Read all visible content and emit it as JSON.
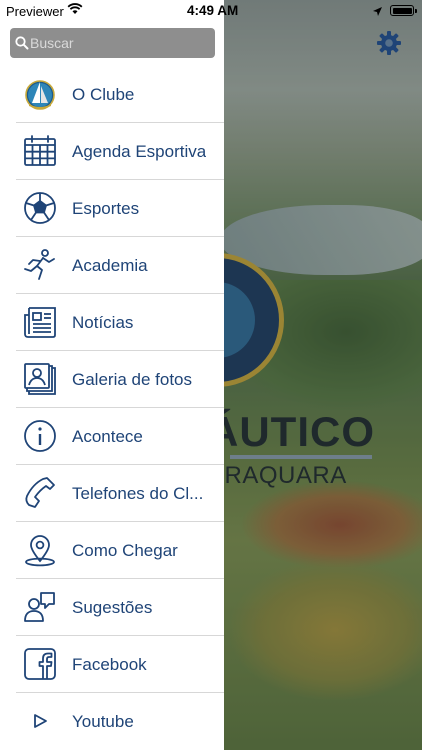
{
  "status_bar": {
    "carrier": "Previewer",
    "time": "4:49 AM",
    "icons": [
      "wifi-icon",
      "location-arrow-icon",
      "battery-icon"
    ],
    "battery_percent": 100
  },
  "search": {
    "placeholder": "Buscar",
    "value": ""
  },
  "menu": {
    "items": [
      {
        "label": "O Clube",
        "icon": "club-logo-icon"
      },
      {
        "label": "Agenda Esportiva",
        "icon": "calendar-icon"
      },
      {
        "label": "Esportes",
        "icon": "soccer-ball-icon"
      },
      {
        "label": "Academia",
        "icon": "running-person-icon"
      },
      {
        "label": "Notícias",
        "icon": "newspaper-icon"
      },
      {
        "label": "Galeria de fotos",
        "icon": "photo-gallery-icon"
      },
      {
        "label": "Acontece",
        "icon": "info-icon"
      },
      {
        "label": "Telefones do Cl...",
        "icon": "phone-icon"
      },
      {
        "label": "Como Chegar",
        "icon": "map-pin-icon"
      },
      {
        "label": "Sugestões",
        "icon": "chat-person-icon"
      },
      {
        "label": "Facebook",
        "icon": "facebook-icon"
      },
      {
        "label": "Youtube",
        "icon": "play-icon"
      }
    ]
  },
  "background": {
    "logo_text_line1": "ÁUTICO",
    "logo_text_line2": "ARAQUARA"
  },
  "colors": {
    "menu_text": "#1f4477",
    "search_bg": "#8e8e8e",
    "divider": "#d7d7d7",
    "settings_icon": "#1f4477"
  }
}
